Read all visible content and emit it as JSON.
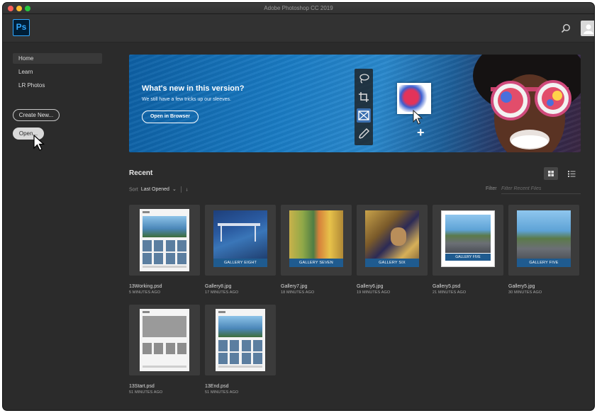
{
  "window": {
    "title": "Adobe Photoshop CC 2019"
  },
  "app": {
    "logo_text": "Ps"
  },
  "sidebar": {
    "items": [
      {
        "label": "Home",
        "active": true
      },
      {
        "label": "Learn",
        "active": false
      },
      {
        "label": "LR Photos",
        "active": false
      }
    ],
    "create_new_label": "Create New...",
    "open_label": "Open..."
  },
  "banner": {
    "heading": "What's new in this version?",
    "subtext": "We still have a few tricks up our sleeves.",
    "button_label": "Open in Browser"
  },
  "recent": {
    "title": "Recent",
    "sort_label": "Sort",
    "sort_value": "Last Opened",
    "filter_label": "Filter",
    "filter_placeholder": "Filter Recent Files",
    "files": [
      {
        "name": "13Working.psd",
        "time": "5 MINUTES AGO",
        "kind": "doc"
      },
      {
        "name": "Gallery8.jpg",
        "time": "17 MINUTES AGO",
        "kind": "art",
        "band": "GALLERY EIGHT"
      },
      {
        "name": "Gallery7.jpg",
        "time": "18 MINUTES AGO",
        "kind": "art",
        "band": "GALLERY SEVEN"
      },
      {
        "name": "Gallery6.jpg",
        "time": "19 MINUTES AGO",
        "kind": "art",
        "band": "GALLERY SIX"
      },
      {
        "name": "Gallery5.psd",
        "time": "21 MINUTES AGO",
        "kind": "framed",
        "band": "GALLERY FIVE"
      },
      {
        "name": "Gallery5.jpg",
        "time": "30 MINUTES AGO",
        "kind": "art",
        "band": "GALLERY FIVE"
      },
      {
        "name": "13Start.psd",
        "time": "51 MINUTES AGO",
        "kind": "doc-gray"
      },
      {
        "name": "13End.psd",
        "time": "51 MINUTES AGO",
        "kind": "doc"
      }
    ]
  },
  "colors": {
    "background": "#2b2b2b",
    "ps_brand": "#31a8ff",
    "gallery_band": "#1f5b8f"
  }
}
